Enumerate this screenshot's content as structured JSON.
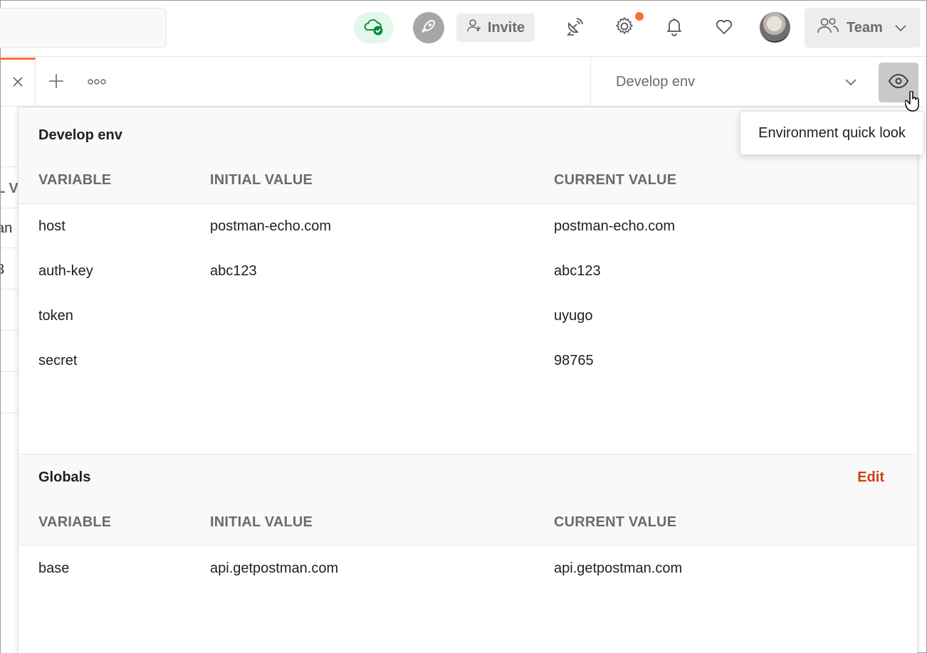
{
  "header": {
    "invite_label": "Invite",
    "team_label": "Team",
    "icons": {
      "sync": "cloud-check-icon",
      "rocket": "rocket-icon",
      "invite": "add-user-icon",
      "satellite": "satellite-icon",
      "settings": "gear-icon",
      "notifications": "bell-icon",
      "heart": "heart-icon",
      "team": "team-icon"
    },
    "colors": {
      "accent": "#ff6c37",
      "sync_bg": "#e3f7ea",
      "sync_check": "#0c8c3b"
    }
  },
  "tabs": {
    "environment_selected": "Develop env"
  },
  "background_fragments": [
    "L V",
    "an",
    "3"
  ],
  "tooltip": {
    "text": "Environment quick look"
  },
  "quicklook": {
    "environment": {
      "title": "Develop env",
      "columns": [
        "VARIABLE",
        "INITIAL VALUE",
        "CURRENT VALUE"
      ],
      "rows": [
        {
          "variable": "host",
          "initial": "postman-echo.com",
          "current": "postman-echo.com"
        },
        {
          "variable": "auth-key",
          "initial": "abc123",
          "current": "abc123"
        },
        {
          "variable": "token",
          "initial": "",
          "current": "uyugo"
        },
        {
          "variable": "secret",
          "initial": "",
          "current": "98765"
        }
      ]
    },
    "globals": {
      "title": "Globals",
      "edit_label": "Edit",
      "columns": [
        "VARIABLE",
        "INITIAL VALUE",
        "CURRENT VALUE"
      ],
      "rows": [
        {
          "variable": "base",
          "initial": "api.getpostman.com",
          "current": "api.getpostman.com"
        }
      ],
      "edit_color": "#d23f0f"
    }
  }
}
